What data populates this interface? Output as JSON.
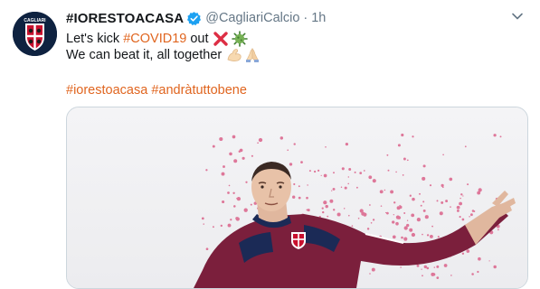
{
  "tweet": {
    "display_name": "#IORESTOACASA",
    "handle": "@CagliariCalcio",
    "separator": "·",
    "time": "1h",
    "line1_text": "Let's kick ",
    "line1_hashtag": "#COVID19",
    "line1_after": " out",
    "line2_text": "We can beat it, all together",
    "hashtag_1": "#iorestoacasa",
    "hashtag_2": "#andràtuttobene",
    "avatar_label": "CAGLIARI"
  },
  "colors": {
    "link": "#e0651f",
    "secondary_text": "#657786",
    "verified": "#1da1f2",
    "jersey": "#7b1f3c",
    "avatar_bg": "#0e2240"
  },
  "icons": {
    "verified": "verified-badge-icon",
    "caret": "chevron-down-icon",
    "cross": "cross-mark-emoji",
    "virus": "microbe-emoji",
    "muscle": "flexed-biceps-emoji",
    "pray": "folded-hands-emoji"
  }
}
